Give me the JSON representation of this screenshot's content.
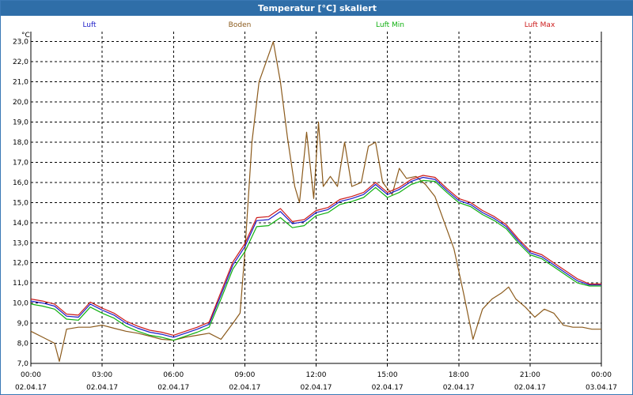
{
  "window": {
    "title": "Temperatur [°C] skaliert"
  },
  "colors": {
    "titlebar": "#2f6ea8"
  },
  "chart_data": {
    "type": "line",
    "title": "Temperatur [°C] skaliert",
    "ylabel": "°C",
    "xlabel": "",
    "ylim": [
      7,
      23.5
    ],
    "xlim": [
      0,
      24
    ],
    "grid": true,
    "legend_position": "top",
    "yticks": [
      "7,0",
      "8,0",
      "9,0",
      "10,0",
      "11,0",
      "12,0",
      "13,0",
      "14,0",
      "15,0",
      "16,0",
      "17,0",
      "18,0",
      "19,0",
      "20,0",
      "21,0",
      "22,0",
      "23,0"
    ],
    "xticks": [
      {
        "time": "00:00",
        "date": "02.04.17"
      },
      {
        "time": "03:00",
        "date": "02.04.17"
      },
      {
        "time": "06:00",
        "date": "02.04.17"
      },
      {
        "time": "09:00",
        "date": "02.04.17"
      },
      {
        "time": "12:00",
        "date": "02.04.17"
      },
      {
        "time": "15:00",
        "date": "02.04.17"
      },
      {
        "time": "18:00",
        "date": "02.04.17"
      },
      {
        "time": "21:00",
        "date": "02.04.17"
      },
      {
        "time": "00:00",
        "date": "03.04.17"
      }
    ],
    "series": [
      {
        "name": "Luft",
        "color": "#1c1cc8",
        "x": [
          0,
          0.5,
          1,
          1.5,
          2,
          2.5,
          3,
          3.5,
          4,
          4.5,
          5,
          5.5,
          6,
          6.5,
          7,
          7.5,
          8,
          8.5,
          9,
          9.5,
          10,
          10.5,
          11,
          11.5,
          12,
          12.5,
          13,
          13.5,
          14,
          14.5,
          15,
          15.5,
          16,
          16.5,
          17,
          17.5,
          18,
          18.5,
          19,
          19.5,
          20,
          20.5,
          21,
          21.5,
          22,
          22.5,
          23,
          23.5,
          24
        ],
        "y": [
          10.1,
          10,
          9.85,
          9.35,
          9.3,
          9.95,
          9.65,
          9.4,
          9,
          8.75,
          8.55,
          8.45,
          8.3,
          8.5,
          8.7,
          8.95,
          10.4,
          11.9,
          12.8,
          14.1,
          14.15,
          14.55,
          13.95,
          14.05,
          14.5,
          14.65,
          15.05,
          15.2,
          15.4,
          15.9,
          15.4,
          15.65,
          16.05,
          16.25,
          16.15,
          15.6,
          15.1,
          14.9,
          14.5,
          14.2,
          13.8,
          13.1,
          12.5,
          12.3,
          11.9,
          11.5,
          11.1,
          10.9,
          10.9
        ]
      },
      {
        "name": "Boden",
        "color": "#8b5a1b",
        "x": [
          0,
          0.5,
          1,
          1.2,
          1.5,
          2,
          2.5,
          3,
          3.5,
          4,
          4.5,
          5,
          5.5,
          6,
          6.5,
          7,
          7.5,
          8,
          8.5,
          8.8,
          9,
          9.3,
          9.6,
          9.9,
          10.2,
          10.5,
          10.8,
          11.1,
          11.3,
          11.6,
          11.9,
          12.1,
          12.3,
          12.6,
          12.9,
          13.2,
          13.5,
          13.9,
          14.2,
          14.5,
          14.8,
          15.2,
          15.5,
          15.8,
          16.2,
          16.6,
          17,
          17.4,
          17.8,
          18.2,
          18.6,
          19,
          19.4,
          19.8,
          20.1,
          20.4,
          20.8,
          21.2,
          21.6,
          22,
          22.4,
          22.8,
          23.2,
          23.6,
          24
        ],
        "y": [
          8.6,
          8.3,
          8,
          7.1,
          8.7,
          8.8,
          8.8,
          8.9,
          8.75,
          8.6,
          8.5,
          8.35,
          8.2,
          8.15,
          8.3,
          8.4,
          8.5,
          8.2,
          9,
          9.5,
          12.5,
          18,
          21,
          22,
          23,
          21,
          18.2,
          15.8,
          15,
          18.5,
          15.2,
          19,
          15.8,
          16.3,
          15.8,
          18,
          15.8,
          16,
          17.8,
          18,
          16,
          15.4,
          16.7,
          16.2,
          16.3,
          15.9,
          15.3,
          14,
          12.7,
          10.5,
          8.2,
          9.7,
          10.2,
          10.5,
          10.8,
          10.2,
          9.8,
          9.3,
          9.7,
          9.5,
          8.9,
          8.8,
          8.8,
          8.7,
          8.7
        ]
      },
      {
        "name": "Luft Min",
        "color": "#10b010",
        "x": [
          0,
          0.5,
          1,
          1.5,
          2,
          2.5,
          3,
          3.5,
          4,
          4.5,
          5,
          5.5,
          6,
          6.5,
          7,
          7.5,
          8,
          8.5,
          9,
          9.5,
          10,
          10.5,
          11,
          11.5,
          12,
          12.5,
          13,
          13.5,
          14,
          14.5,
          15,
          15.5,
          16,
          16.5,
          17,
          17.5,
          18,
          18.5,
          19,
          19.5,
          20,
          20.5,
          21,
          21.5,
          22,
          22.5,
          23,
          23.5,
          24
        ],
        "y": [
          9.95,
          9.85,
          9.7,
          9.2,
          9.15,
          9.8,
          9.5,
          9.25,
          8.85,
          8.6,
          8.4,
          8.3,
          8.15,
          8.35,
          8.55,
          8.8,
          10.2,
          11.7,
          12.55,
          13.8,
          13.85,
          14.25,
          13.75,
          13.85,
          14.35,
          14.5,
          14.9,
          15.05,
          15.25,
          15.75,
          15.25,
          15.5,
          15.9,
          16.1,
          16.05,
          15.5,
          15,
          14.8,
          14.4,
          14.1,
          13.7,
          13,
          12.4,
          12.2,
          11.8,
          11.4,
          11,
          10.85,
          10.85
        ]
      },
      {
        "name": "Luft Max",
        "color": "#cc1a1a",
        "x": [
          0,
          0.5,
          1,
          1.5,
          2,
          2.5,
          3,
          3.5,
          4,
          4.5,
          5,
          5.5,
          6,
          6.5,
          7,
          7.5,
          8,
          8.5,
          9,
          9.5,
          10,
          10.5,
          11,
          11.5,
          12,
          12.5,
          13,
          13.5,
          14,
          14.5,
          15,
          15.5,
          16,
          16.5,
          17,
          17.5,
          18,
          18.5,
          19,
          19.5,
          20,
          20.5,
          21,
          21.5,
          22,
          22.5,
          23,
          23.5,
          24
        ],
        "y": [
          10.2,
          10.1,
          9.95,
          9.45,
          9.4,
          10.05,
          9.75,
          9.5,
          9.1,
          8.85,
          8.65,
          8.55,
          8.4,
          8.6,
          8.8,
          9.05,
          10.55,
          12.05,
          12.95,
          14.25,
          14.3,
          14.7,
          14.05,
          14.15,
          14.6,
          14.75,
          15.15,
          15.3,
          15.5,
          16,
          15.5,
          15.75,
          16.15,
          16.35,
          16.25,
          15.7,
          15.2,
          15,
          14.6,
          14.3,
          13.9,
          13.2,
          12.6,
          12.4,
          12,
          11.6,
          11.2,
          10.95,
          10.95
        ]
      }
    ]
  }
}
